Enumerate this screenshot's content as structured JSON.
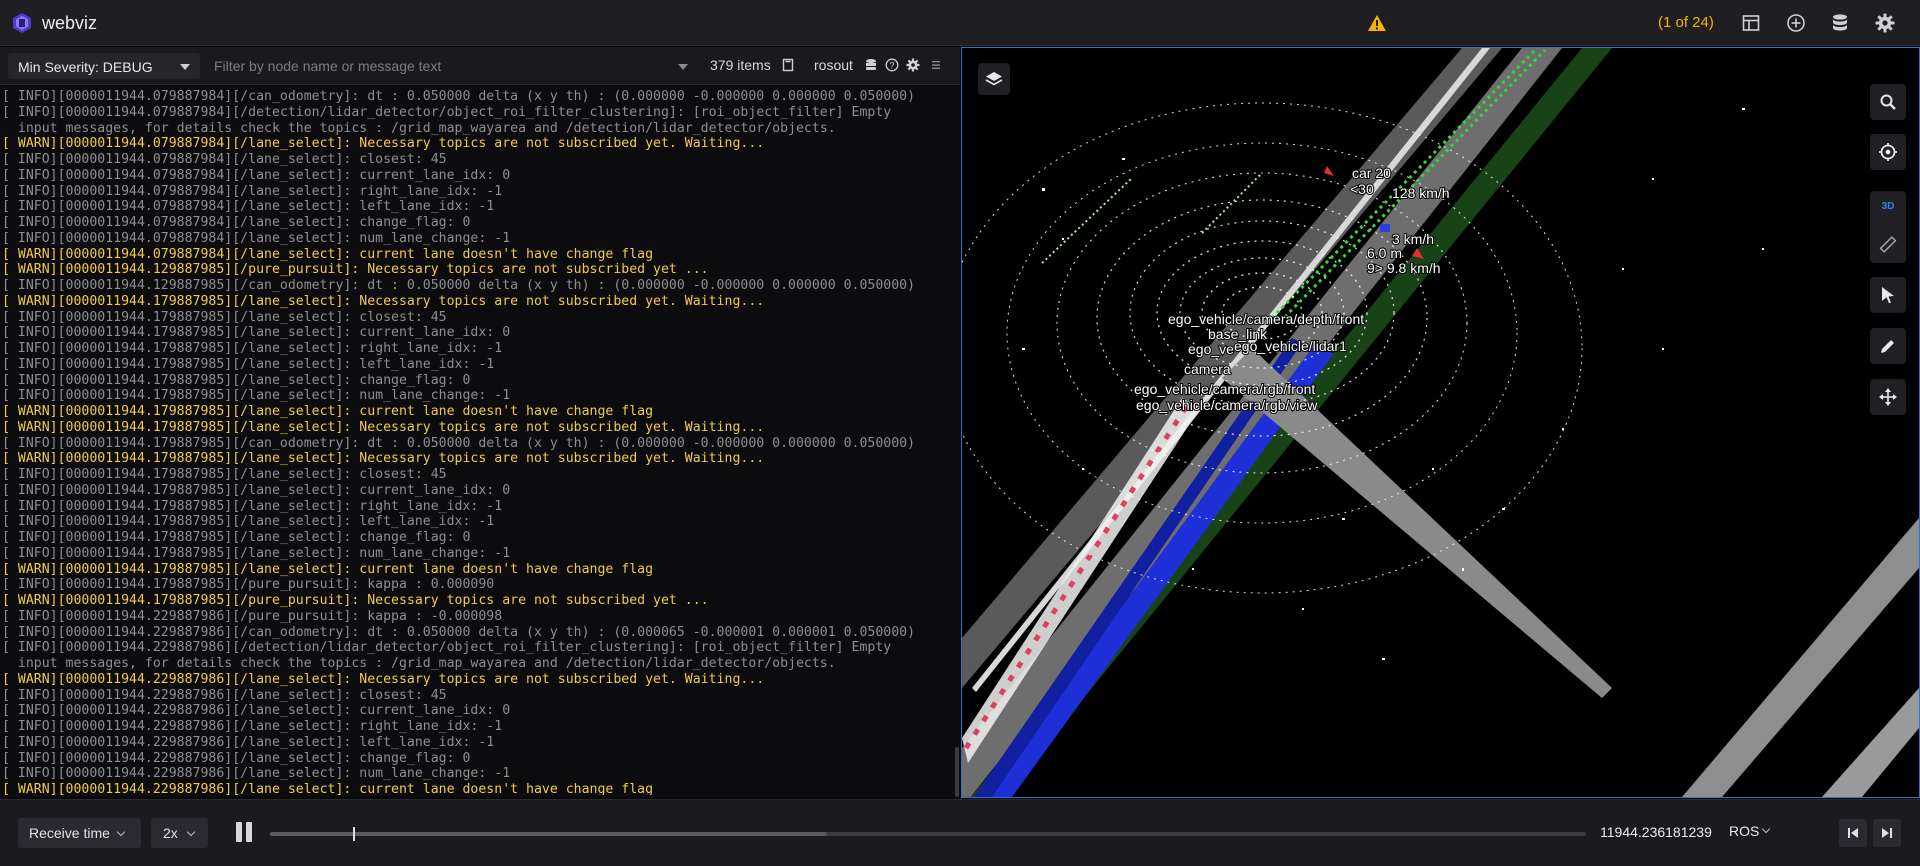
{
  "app": {
    "title": "webviz",
    "problem_count": "(1 of 24)"
  },
  "colors": {
    "accent": "#2f74d0",
    "warning": "#f4b400",
    "warn_text": "#f3c94c",
    "info_text": "#8e8e93"
  },
  "log_panel": {
    "severity_label": "Min Severity: DEBUG",
    "filter_placeholder": "Filter by node name or message text",
    "items_count": "379 items",
    "topic": "rosout",
    "lines": [
      {
        "level": "info",
        "text": "[ INFO][0000011944.079887984][/can_odometry]: dt : 0.050000 delta (x y th) : (0.000000 -0.000000 0.000000 0.050000)"
      },
      {
        "level": "info",
        "text": "[ INFO][0000011944.079887984][/detection/lidar_detector/object_roi_filter_clustering]: [roi_object_filter] Empty"
      },
      {
        "level": "info",
        "text": "  input messages, for details check the topics : /grid_map_wayarea and /detection/lidar_detector/objects."
      },
      {
        "level": "warn",
        "text": "[ WARN][0000011944.079887984][/lane_select]: Necessary topics are not subscribed yet. Waiting..."
      },
      {
        "level": "info",
        "text": "[ INFO][0000011944.079887984][/lane_select]: closest: 45"
      },
      {
        "level": "info",
        "text": "[ INFO][0000011944.079887984][/lane_select]: current_lane_idx: 0"
      },
      {
        "level": "info",
        "text": "[ INFO][0000011944.079887984][/lane_select]: right_lane_idx: -1"
      },
      {
        "level": "info",
        "text": "[ INFO][0000011944.079887984][/lane_select]: left_lane_idx: -1"
      },
      {
        "level": "info",
        "text": "[ INFO][0000011944.079887984][/lane_select]: change_flag: 0"
      },
      {
        "level": "info",
        "text": "[ INFO][0000011944.079887984][/lane_select]: num_lane_change: -1"
      },
      {
        "level": "warn",
        "text": "[ WARN][0000011944.079887984][/lane_select]: current lane doesn't have change flag"
      },
      {
        "level": "warn",
        "text": "[ WARN][0000011944.129887985][/pure_pursuit]: Necessary topics are not subscribed yet ..."
      },
      {
        "level": "info",
        "text": "[ INFO][0000011944.129887985][/can_odometry]: dt : 0.050000 delta (x y th) : (0.000000 -0.000000 0.000000 0.050000)"
      },
      {
        "level": "warn",
        "text": "[ WARN][0000011944.179887985][/lane_select]: Necessary topics are not subscribed yet. Waiting..."
      },
      {
        "level": "info",
        "text": "[ INFO][0000011944.179887985][/lane_select]: closest: 45"
      },
      {
        "level": "info",
        "text": "[ INFO][0000011944.179887985][/lane_select]: current_lane_idx: 0"
      },
      {
        "level": "info",
        "text": "[ INFO][0000011944.179887985][/lane_select]: right_lane_idx: -1"
      },
      {
        "level": "info",
        "text": "[ INFO][0000011944.179887985][/lane_select]: left_lane_idx: -1"
      },
      {
        "level": "info",
        "text": "[ INFO][0000011944.179887985][/lane_select]: change_flag: 0"
      },
      {
        "level": "info",
        "text": "[ INFO][0000011944.179887985][/lane_select]: num_lane_change: -1"
      },
      {
        "level": "warn",
        "text": "[ WARN][0000011944.179887985][/lane_select]: current lane doesn't have change flag"
      },
      {
        "level": "warn",
        "text": "[ WARN][0000011944.179887985][/lane_select]: Necessary topics are not subscribed yet. Waiting..."
      },
      {
        "level": "info",
        "text": "[ INFO][0000011944.179887985][/can_odometry]: dt : 0.050000 delta (x y th) : (0.000000 -0.000000 0.000000 0.050000)"
      },
      {
        "level": "warn",
        "text": "[ WARN][0000011944.179887985][/lane_select]: Necessary topics are not subscribed yet. Waiting..."
      },
      {
        "level": "info",
        "text": "[ INFO][0000011944.179887985][/lane_select]: closest: 45"
      },
      {
        "level": "info",
        "text": "[ INFO][0000011944.179887985][/lane_select]: current_lane_idx: 0"
      },
      {
        "level": "info",
        "text": "[ INFO][0000011944.179887985][/lane_select]: right_lane_idx: -1"
      },
      {
        "level": "info",
        "text": "[ INFO][0000011944.179887985][/lane_select]: left_lane_idx: -1"
      },
      {
        "level": "info",
        "text": "[ INFO][0000011944.179887985][/lane_select]: change_flag: 0"
      },
      {
        "level": "info",
        "text": "[ INFO][0000011944.179887985][/lane_select]: num_lane_change: -1"
      },
      {
        "level": "warn",
        "text": "[ WARN][0000011944.179887985][/lane_select]: current lane doesn't have change flag"
      },
      {
        "level": "info",
        "text": "[ INFO][0000011944.179887985][/pure_pursuit]: kappa : 0.000090"
      },
      {
        "level": "warn",
        "text": "[ WARN][0000011944.179887985][/pure_pursuit]: Necessary topics are not subscribed yet ..."
      },
      {
        "level": "info",
        "text": "[ INFO][0000011944.229887986][/pure_pursuit]: kappa : -0.000098"
      },
      {
        "level": "info",
        "text": "[ INFO][0000011944.229887986][/can_odometry]: dt : 0.050000 delta (x y th) : (0.000065 -0.000001 0.000001 0.050000)"
      },
      {
        "level": "info",
        "text": "[ INFO][0000011944.229887986][/detection/lidar_detector/object_roi_filter_clustering]: [roi_object_filter] Empty"
      },
      {
        "level": "info",
        "text": "  input messages, for details check the topics : /grid_map_wayarea and /detection/lidar_detector/objects."
      },
      {
        "level": "warn",
        "text": "[ WARN][0000011944.229887986][/lane_select]: Necessary topics are not subscribed yet. Waiting..."
      },
      {
        "level": "info",
        "text": "[ INFO][0000011944.229887986][/lane_select]: closest: 45"
      },
      {
        "level": "info",
        "text": "[ INFO][0000011944.229887986][/lane_select]: current_lane_idx: 0"
      },
      {
        "level": "info",
        "text": "[ INFO][0000011944.229887986][/lane_select]: right_lane_idx: -1"
      },
      {
        "level": "info",
        "text": "[ INFO][0000011944.229887986][/lane_select]: left_lane_idx: -1"
      },
      {
        "level": "info",
        "text": "[ INFO][0000011944.229887986][/lane_select]: change_flag: 0"
      },
      {
        "level": "info",
        "text": "[ INFO][0000011944.229887986][/lane_select]: num_lane_change: -1"
      },
      {
        "level": "warn",
        "text": "[ WARN][0000011944.229887986][/lane_select]: current lane doesn't have change flag"
      }
    ]
  },
  "view3d": {
    "button_3d_label": "3D",
    "labels": {
      "car": "car 20",
      "speed_a": "<30",
      "speed_b": "128 km/h",
      "speed_c": "3 km/h",
      "dist": "6.0 m",
      "speed_d": "9> 9.8 km/h",
      "depth_front": "ego_vehicle/camera/depth/front",
      "base_link": "base_link",
      "ego_ve": "ego_ve",
      "lidar": "ego_vehicle/lidar1",
      "camera": "camera",
      "rgb_front": "ego_vehicle/camera/rgb/front",
      "rgb_view": "ego_vehicle/camera/rgb/view"
    },
    "icons": [
      "layers-icon",
      "search-icon",
      "crosshair-icon",
      "ruler-icon",
      "cursor-icon",
      "pencil-icon",
      "move-icon"
    ]
  },
  "playback": {
    "time_mode": "Receive time",
    "speed": "2x",
    "timestamp": "11944.236181239",
    "time_format": "ROS",
    "progress": 0.063,
    "loaded": 0.423
  }
}
